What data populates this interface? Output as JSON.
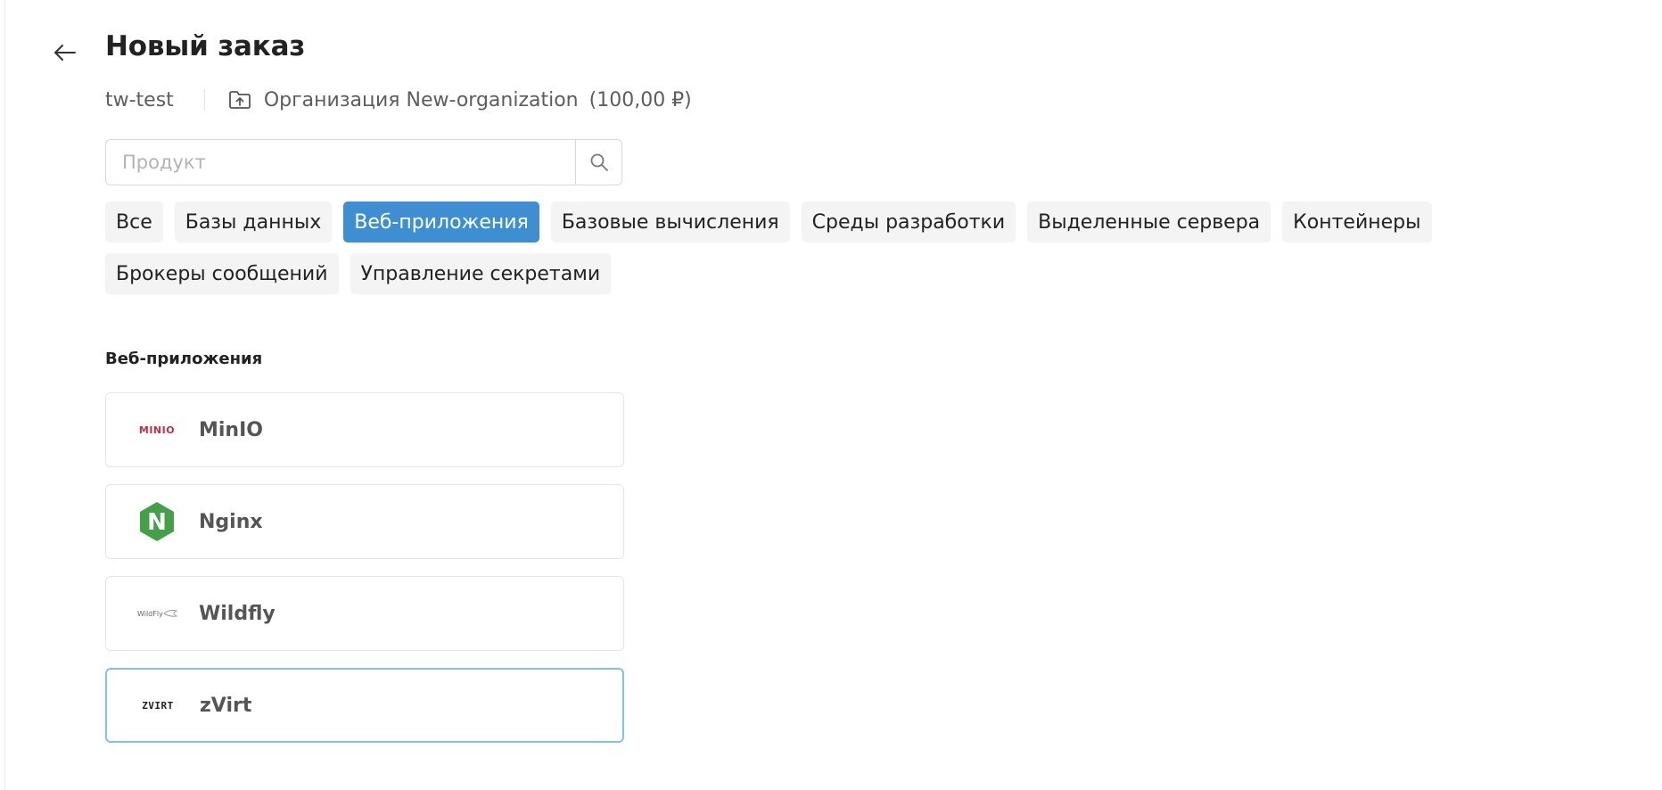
{
  "header": {
    "title": "Новый заказ",
    "back_icon": "arrow-left-icon"
  },
  "context": {
    "project": "tw-test",
    "folder_icon": "folder-upload-icon",
    "organization": "Организация New-organization",
    "balance": "(100,00 ₽)"
  },
  "search": {
    "placeholder": "Продукт",
    "value": "",
    "icon": "search-icon"
  },
  "categories": [
    {
      "label": "Все",
      "active": false
    },
    {
      "label": "Базы данных",
      "active": false
    },
    {
      "label": "Веб-приложения",
      "active": true
    },
    {
      "label": "Базовые вычисления",
      "active": false
    },
    {
      "label": "Среды разработки",
      "active": false
    },
    {
      "label": "Выделенные сервера",
      "active": false
    },
    {
      "label": "Контейнеры",
      "active": false
    },
    {
      "label": "Брокеры сообщений",
      "active": false
    },
    {
      "label": "Управление секретами",
      "active": false
    }
  ],
  "section": {
    "title": "Веб-приложения"
  },
  "products": [
    {
      "name": "MinIO",
      "logo_text": "MINIO",
      "icon": "minio-logo",
      "selected": false
    },
    {
      "name": "Nginx",
      "logo_text": "N",
      "icon": "nginx-logo",
      "selected": false
    },
    {
      "name": "Wildfly",
      "logo_text": "WildFly",
      "icon": "wildfly-logo",
      "selected": false
    },
    {
      "name": "zVirt",
      "logo_text": "ZVIRT",
      "icon": "zvirt-logo",
      "selected": true
    }
  ],
  "colors": {
    "accent": "#3d8fd1",
    "selected_border": "#7ec3e8",
    "chip_bg": "#f4f4f4",
    "nginx_green": "#43a047",
    "minio_red": "#c72c48"
  }
}
